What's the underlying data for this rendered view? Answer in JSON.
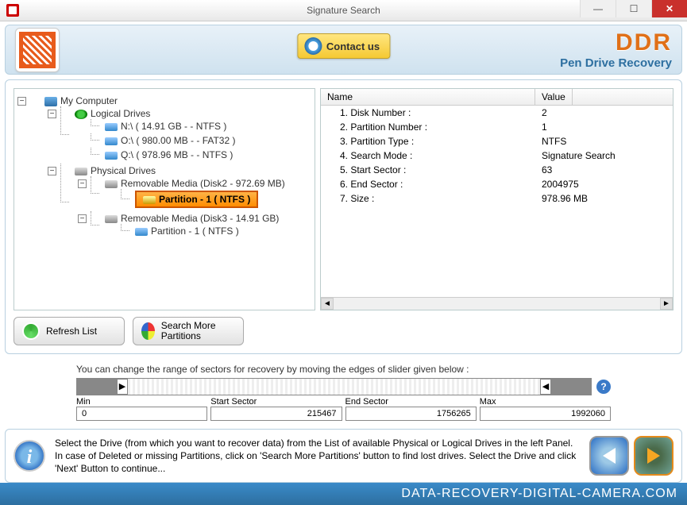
{
  "window": {
    "title": "Signature Search"
  },
  "header": {
    "contact": "Contact us",
    "brand": "DDR",
    "tagline": "Pen Drive Recovery"
  },
  "tree": {
    "root": "My Computer",
    "logical_label": "Logical Drives",
    "logical": [
      "N:\\ ( 14.91 GB -  - NTFS )",
      "O:\\ ( 980.00 MB -  - FAT32 )",
      "Q:\\ ( 978.96 MB -  - NTFS )"
    ],
    "physical_label": "Physical Drives",
    "rem1": "Removable Media  (Disk2 - 972.69 MB)",
    "rem1_part": "Partition - 1 ( NTFS )",
    "rem2": "Removable Media  (Disk3 - 14.91 GB)",
    "rem2_part": "Partition - 1 ( NTFS )"
  },
  "info_header": {
    "name": "Name",
    "value": "Value"
  },
  "info": [
    {
      "n": "1. Disk Number :",
      "v": "2"
    },
    {
      "n": "2. Partition Number :",
      "v": "1"
    },
    {
      "n": "3. Partition Type :",
      "v": "NTFS"
    },
    {
      "n": "4. Search Mode :",
      "v": "Signature Search"
    },
    {
      "n": "5. Start Sector :",
      "v": "63"
    },
    {
      "n": "6. End Sector :",
      "v": "2004975"
    },
    {
      "n": "7. Size :",
      "v": "978.96 MB"
    }
  ],
  "buttons": {
    "refresh": "Refresh List",
    "search_more": "Search More Partitions"
  },
  "sector": {
    "hint": "You can change the range of sectors for recovery by moving the edges of slider given below :",
    "min_l": "Min",
    "min": "0",
    "ss_l": "Start Sector",
    "ss": "215467",
    "es_l": "End Sector",
    "es": "1756265",
    "max_l": "Max",
    "max": "1992060"
  },
  "footer_text": "Select the Drive (from which you want to recover data) from the List of available Physical or Logical Drives in the left Panel. In case of Deleted or missing Partitions, click on 'Search More Partitions' button to find lost drives. Select the Drive and click 'Next' Button to continue...",
  "site": "DATA-RECOVERY-DIGITAL-CAMERA.COM"
}
